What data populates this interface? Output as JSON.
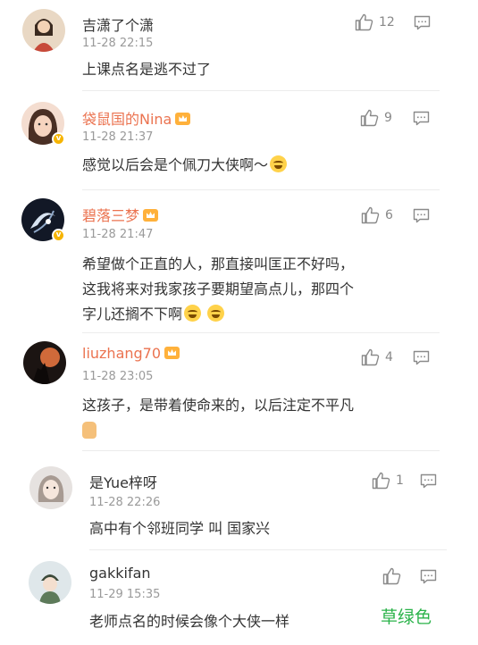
{
  "comments": [
    {
      "user": "吉潇了个潇",
      "time": "11-28 22:15",
      "text": [
        "上课点名是逃不过了"
      ],
      "likes": "12",
      "vip": false
    },
    {
      "user": "袋鼠国的Nina",
      "time": "11-28 21:37",
      "text": [
        "感觉以后会是个佩刀大侠啊～"
      ],
      "likes": "9",
      "vip": true
    },
    {
      "user": "碧落三梦",
      "time": "11-28 21:47",
      "text": [
        "希望做个正直的人，那直接叫匡正不好吗，",
        "这我将来对我家孩子要期望高点儿，那四个",
        "字儿还搁不下啊"
      ],
      "likes": "6",
      "vip": true
    },
    {
      "user": "liuzhang70",
      "time": "11-28 23:05",
      "text": [
        "这孩子，是带着使命来的，以后注定不平凡"
      ],
      "likes": "4",
      "vip": true
    },
    {
      "user": "是Yue梓呀",
      "time": "11-28 22:26",
      "text": [
        "高中有个邻班同学 叫 国家兴"
      ],
      "likes": "1",
      "vip": false
    },
    {
      "user": "gakkifan",
      "time": "11-29 15:35",
      "text": [
        "老师点名的时候会像个大侠一样"
      ],
      "likes": "",
      "vip": false
    }
  ],
  "watermark": "草绿色",
  "icons": {
    "like": "thumbs-up-icon",
    "reply": "comment-icon",
    "vip": "vip-crown-icon",
    "verified": "verified-badge-icon"
  },
  "colors": {
    "vip_name": "#eb7350",
    "watermark": "#2bb34a",
    "badge": "#f6b400"
  }
}
